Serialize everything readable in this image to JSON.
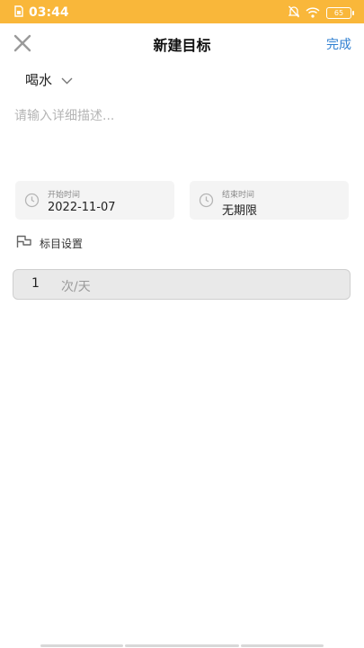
{
  "status_bar": {
    "time": "03:44",
    "battery": "65",
    "icons": [
      "sim-card-icon",
      "mute-icon",
      "wifi-icon",
      "battery-icon"
    ],
    "background_color": "#f9b73a"
  },
  "nav": {
    "title": "新建目标",
    "done_label": "完成",
    "done_color": "#2f7fd1",
    "close_icon": "close-icon"
  },
  "category": {
    "selected": "喝水",
    "icon": "chevron-down-icon"
  },
  "description": {
    "placeholder": "请输入详细描述...",
    "value": ""
  },
  "dates": {
    "start": {
      "caption": "开始时间",
      "value": "2022-11-07",
      "icon": "clock-icon"
    },
    "end": {
      "caption": "结束时间",
      "value": "无期限",
      "icon": "clock-icon"
    }
  },
  "target_settings": {
    "label": "标目设置",
    "icon": "flag-icon"
  },
  "frequency": {
    "value": "1",
    "unit": "次/天"
  }
}
